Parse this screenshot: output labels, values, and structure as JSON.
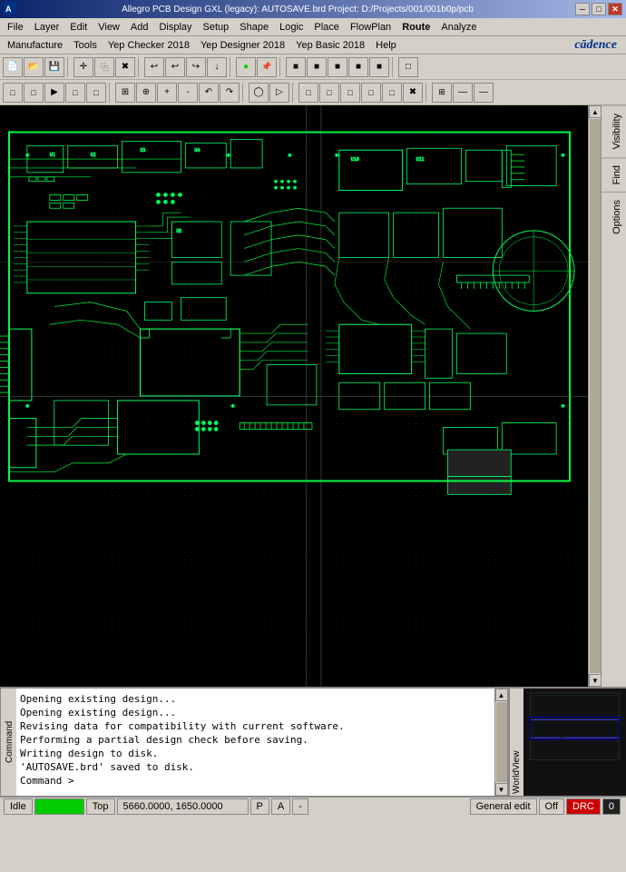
{
  "titlebar": {
    "title": "Allegro PCB Design GXL (legacy): AUTOSAVE.brd  Project: D:/Projects/001/001b0p/pcb",
    "minimize": "─",
    "maximize": "□",
    "close": "✕"
  },
  "menubar1": {
    "items": [
      "File",
      "Layer",
      "Edit",
      "View",
      "Add",
      "Display",
      "Setup",
      "Shape",
      "Logic",
      "Place",
      "FlowPlan",
      "Route",
      "Analyze"
    ]
  },
  "menubar2": {
    "items": [
      "Manufacture",
      "Tools",
      "Yep Checker 2018",
      "Yep Designer 2018",
      "Yep Basic 2018",
      "Help"
    ],
    "cadence_logo": "cādence"
  },
  "toolbars": {
    "row1": [
      {
        "name": "new",
        "icon": "📄"
      },
      {
        "name": "open",
        "icon": "📂"
      },
      {
        "name": "save",
        "icon": "💾"
      },
      {
        "name": "cross",
        "icon": "✛"
      },
      {
        "name": "copy",
        "icon": "⿻"
      },
      {
        "name": "delete",
        "icon": "✖"
      },
      {
        "name": "undo",
        "icon": "↩"
      },
      {
        "name": "undo2",
        "icon": "↩"
      },
      {
        "name": "redo",
        "icon": "↪"
      },
      {
        "name": "down",
        "icon": "↓"
      },
      {
        "name": "circle",
        "icon": "●"
      },
      {
        "name": "pin",
        "icon": "📌"
      },
      {
        "sep": true
      },
      {
        "name": "sq1",
        "icon": "■"
      },
      {
        "name": "sq2",
        "icon": "■"
      },
      {
        "name": "sq3",
        "icon": "■"
      },
      {
        "name": "sq4",
        "icon": "■"
      },
      {
        "name": "sq5",
        "icon": "■"
      },
      {
        "sep": true
      },
      {
        "name": "sq6",
        "icon": "□"
      }
    ],
    "row2": [
      {
        "name": "r1",
        "icon": "□"
      },
      {
        "name": "r2",
        "icon": "□"
      },
      {
        "name": "r3",
        "icon": "▶"
      },
      {
        "name": "r4",
        "icon": "□"
      },
      {
        "name": "r5",
        "icon": "□"
      },
      {
        "sep": true
      },
      {
        "name": "r6",
        "icon": "□"
      },
      {
        "sep": true
      },
      {
        "name": "r7",
        "icon": "◯"
      },
      {
        "name": "r8",
        "icon": "▷"
      },
      {
        "sep": true
      },
      {
        "name": "r9",
        "icon": "□"
      },
      {
        "name": "r10",
        "icon": "□"
      },
      {
        "name": "r11",
        "icon": "□"
      },
      {
        "name": "r12",
        "icon": "□"
      },
      {
        "name": "r13",
        "icon": "□"
      },
      {
        "name": "r14",
        "icon": "✖"
      },
      {
        "sep": true
      },
      {
        "name": "r15",
        "icon": "□"
      },
      {
        "name": "r16",
        "icon": "⊞"
      },
      {
        "name": "r17",
        "icon": "⊟"
      }
    ]
  },
  "right_panel": {
    "tabs": [
      "Visibility",
      "Find",
      "Options"
    ]
  },
  "console": {
    "label": "Command",
    "lines": [
      "Opening existing design...",
      "Opening existing design...",
      "Revising data for compatibility with current software.",
      "Performing a partial design check before saving.",
      "Writing design to disk.",
      "'AUTOSAVE.brd' saved to disk.",
      "Command >"
    ]
  },
  "worldview": {
    "label": "WorldView"
  },
  "statusbar": {
    "idle": "Idle",
    "green_indicator": "",
    "layer": "Top",
    "coordinates": "5660.0000, 1650.0000",
    "p_indicator": "P",
    "a_indicator": "A",
    "dash": "-",
    "general_edit": "General edit",
    "off": "Off",
    "drc": "DRC",
    "number": "0"
  }
}
